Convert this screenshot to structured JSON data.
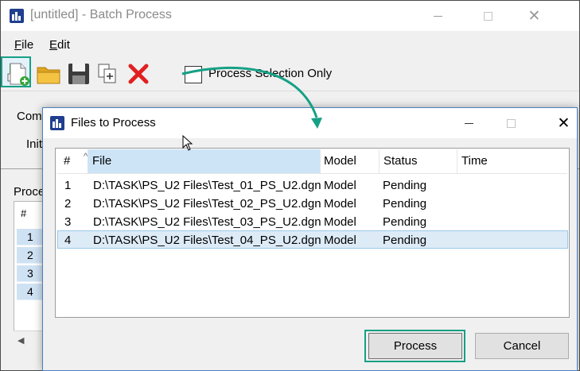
{
  "main_window": {
    "title": "[untitled] - Batch Process",
    "menu": [
      "File",
      "Edit"
    ],
    "toolbar": {
      "icons": [
        "new-file-icon",
        "open-folder-icon",
        "save-icon",
        "copy-icon",
        "delete-icon",
        "process-selection-icon"
      ],
      "process_selection_label": "Process Selection Only",
      "process_selection_checked": false
    },
    "body": {
      "command_label": "Com",
      "initial_label": "Init",
      "process_label": "Proce",
      "list_header": "#",
      "list_rows": [
        "1",
        "2",
        "3",
        "4"
      ]
    }
  },
  "dialog": {
    "title": "Files to Process",
    "columns": {
      "num": "#",
      "file": "File",
      "model": "Model",
      "status": "Status",
      "time": "Time"
    },
    "rows": [
      {
        "num": "1",
        "file": "D:\\TASK\\PS_U2 Files\\Test_01_PS_U2.dgn",
        "model": "Model",
        "status": "Pending",
        "time": ""
      },
      {
        "num": "2",
        "file": "D:\\TASK\\PS_U2 Files\\Test_02_PS_U2.dgn",
        "model": "Model",
        "status": "Pending",
        "time": ""
      },
      {
        "num": "3",
        "file": "D:\\TASK\\PS_U2 Files\\Test_03_PS_U2.dgn",
        "model": "Model",
        "status": "Pending",
        "time": ""
      },
      {
        "num": "4",
        "file": "D:\\TASK\\PS_U2 Files\\Test_04_PS_U2.dgn",
        "model": "Model",
        "status": "Pending",
        "time": ""
      }
    ],
    "selected_row": 4,
    "buttons": {
      "process": "Process",
      "cancel": "Cancel"
    }
  },
  "colors": {
    "highlight": "#16a085",
    "selection": "#ddebf7",
    "app_icon": "#1f3f8f"
  }
}
